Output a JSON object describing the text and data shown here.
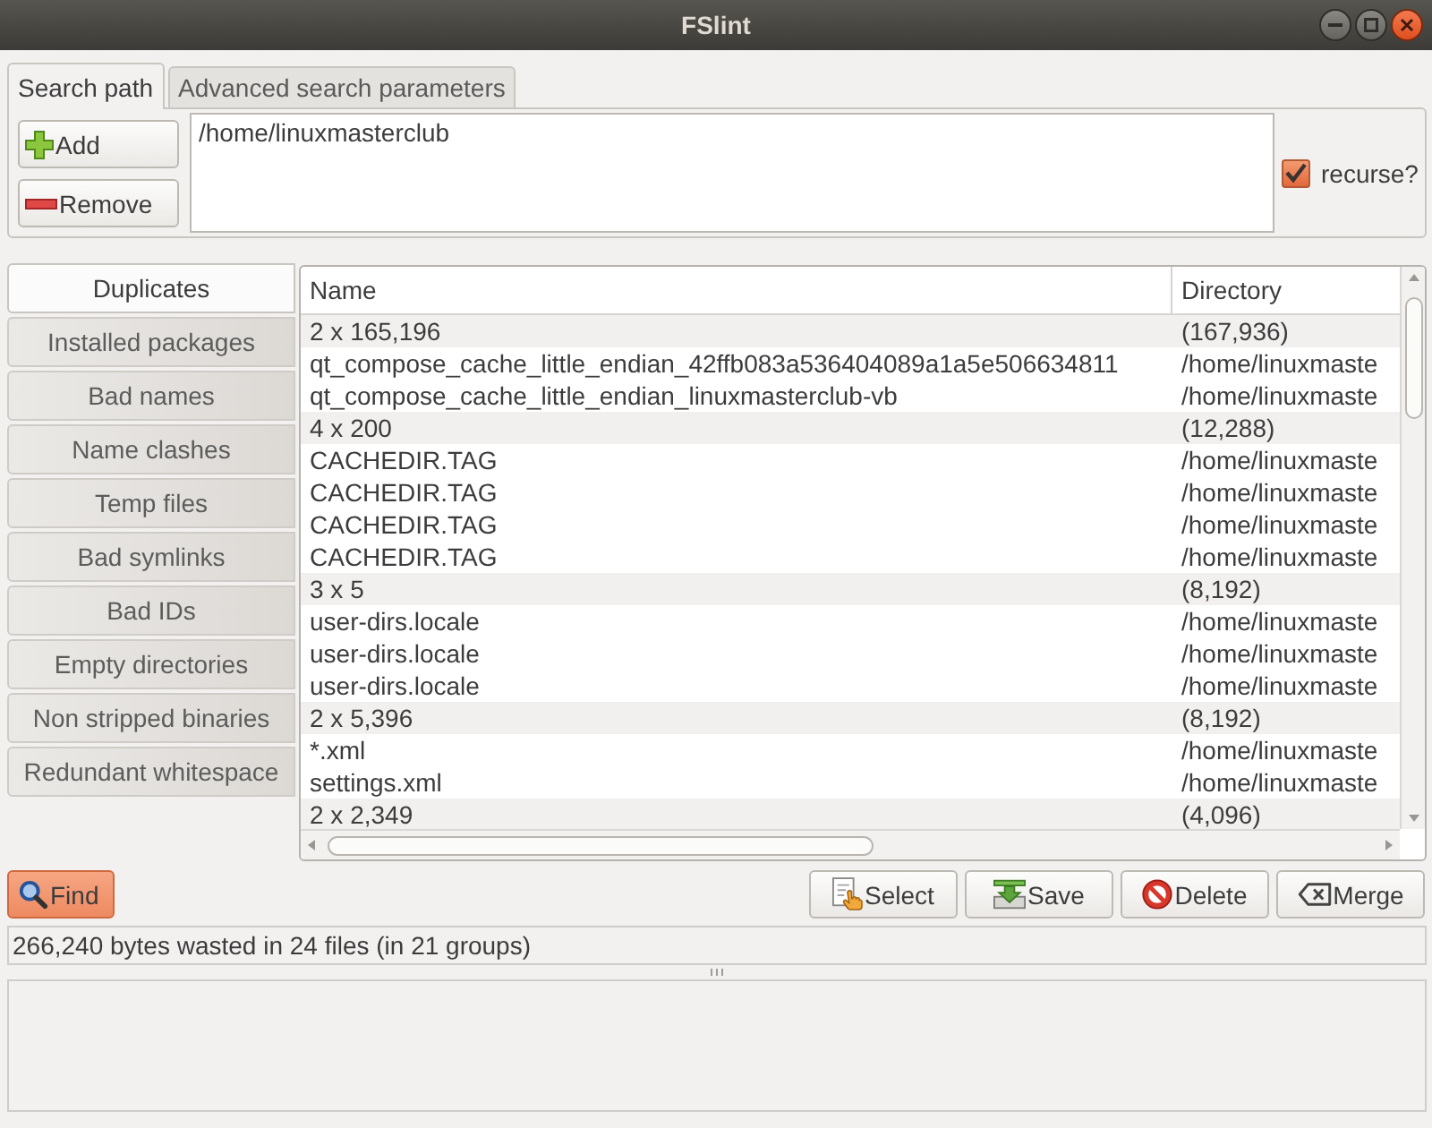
{
  "window": {
    "title": "FSlint"
  },
  "search_tabs": [
    {
      "label": "Search path",
      "selected": true
    },
    {
      "label": "Advanced search parameters",
      "selected": false
    }
  ],
  "search_path": {
    "add_button": "Add",
    "remove_button": "Remove",
    "paths": [
      "/home/linuxmasterclub"
    ],
    "recurse": {
      "label": "recurse?",
      "checked": true
    }
  },
  "modes": [
    {
      "label": "Duplicates",
      "selected": true
    },
    {
      "label": "Installed packages",
      "selected": false
    },
    {
      "label": "Bad names",
      "selected": false
    },
    {
      "label": "Name clashes",
      "selected": false
    },
    {
      "label": "Temp files",
      "selected": false
    },
    {
      "label": "Bad symlinks",
      "selected": false
    },
    {
      "label": "Bad IDs",
      "selected": false
    },
    {
      "label": "Empty directories",
      "selected": false
    },
    {
      "label": "Non stripped binaries",
      "selected": false
    },
    {
      "label": "Redundant whitespace",
      "selected": false
    }
  ],
  "table": {
    "columns": [
      "Name",
      "Directory"
    ],
    "rows": [
      {
        "kind": "group",
        "name": "2 x 165,196",
        "directory": "(167,936)"
      },
      {
        "kind": "file",
        "name": "qt_compose_cache_little_endian_42ffb083a536404089a1a5e506634811",
        "directory": "/home/linuxmaste"
      },
      {
        "kind": "file",
        "name": "qt_compose_cache_little_endian_linuxmasterclub-vb",
        "directory": "/home/linuxmaste"
      },
      {
        "kind": "group",
        "name": "4 x 200",
        "directory": "(12,288)"
      },
      {
        "kind": "file",
        "name": "CACHEDIR.TAG",
        "directory": "/home/linuxmaste"
      },
      {
        "kind": "file",
        "name": "CACHEDIR.TAG",
        "directory": "/home/linuxmaste"
      },
      {
        "kind": "file",
        "name": "CACHEDIR.TAG",
        "directory": "/home/linuxmaste"
      },
      {
        "kind": "file",
        "name": "CACHEDIR.TAG",
        "directory": "/home/linuxmaste"
      },
      {
        "kind": "group",
        "name": "3 x 5",
        "directory": "(8,192)"
      },
      {
        "kind": "file",
        "name": "user-dirs.locale",
        "directory": "/home/linuxmaste"
      },
      {
        "kind": "file",
        "name": "user-dirs.locale",
        "directory": "/home/linuxmaste"
      },
      {
        "kind": "file",
        "name": "user-dirs.locale",
        "directory": "/home/linuxmaste"
      },
      {
        "kind": "group",
        "name": "2 x 5,396",
        "directory": "(8,192)"
      },
      {
        "kind": "file",
        "name": "*.xml",
        "directory": "/home/linuxmaste"
      },
      {
        "kind": "file",
        "name": "settings.xml",
        "directory": "/home/linuxmaste"
      },
      {
        "kind": "group",
        "name": "2 x 2,349",
        "directory": "(4,096)"
      }
    ]
  },
  "find_button": {
    "label": "Find",
    "focused": true
  },
  "actions": {
    "select": "Select",
    "save": "Save",
    "delete": "Delete",
    "merge": "Merge"
  },
  "status_bar": "266,240 bytes wasted in 24 files (in 21 groups)"
}
